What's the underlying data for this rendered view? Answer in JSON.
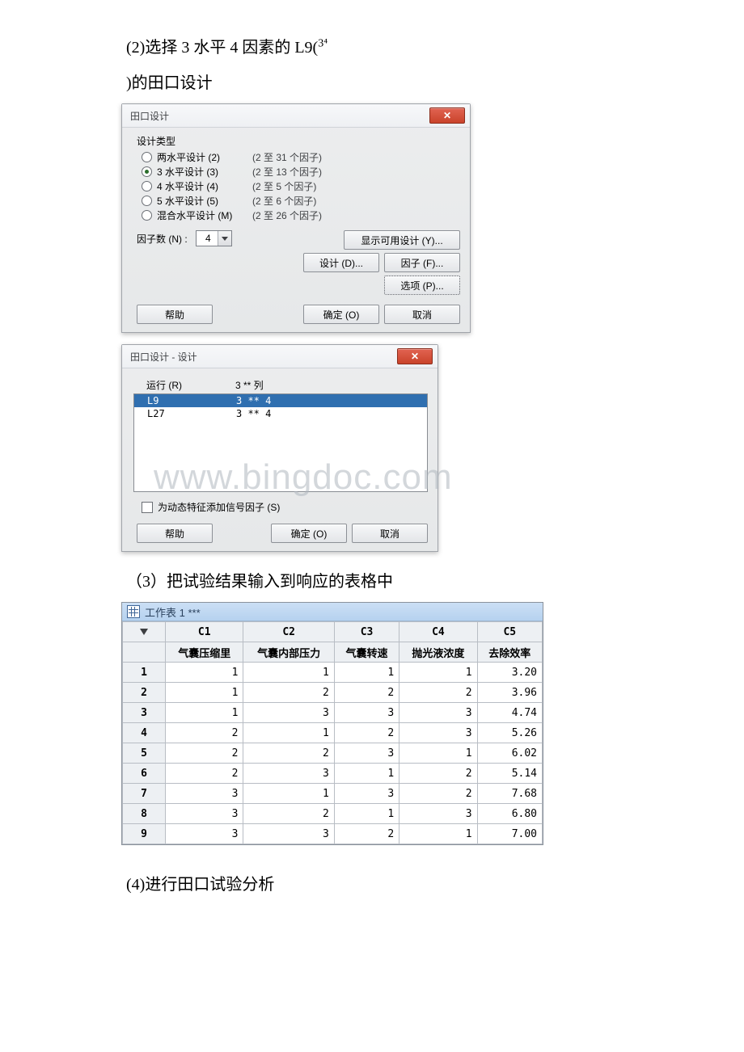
{
  "text": {
    "p1a": "(2)选择 3 水平 4 因素的 L9(",
    "p1sup": "3⁴",
    "p1b": ")的田口设计",
    "p3": "（3）把试验结果输入到响应的表格中",
    "p4": "(4)进行田口试验分析"
  },
  "watermark": "www.bingdoc.com",
  "dialog1": {
    "title": "田口设计",
    "group": "设计类型",
    "radios": [
      {
        "label": "两水平设计 (2)",
        "paren": "(2 至 31 个因子)",
        "selected": false
      },
      {
        "label": "3 水平设计 (3)",
        "paren": "(2 至 13 个因子)",
        "selected": true
      },
      {
        "label": "4 水平设计 (4)",
        "paren": "(2 至 5 个因子)",
        "selected": false
      },
      {
        "label": "5 水平设计 (5)",
        "paren": "(2 至 6 个因子)",
        "selected": false
      },
      {
        "label": "混合水平设计 (M)",
        "paren": "(2 至 26 个因子)",
        "selected": false
      }
    ],
    "factor_label": "因子数 (N) :",
    "factor_value": "4",
    "btn_show": "显示可用设计 (Y)...",
    "btn_design": "设计 (D)...",
    "btn_factor": "因子 (F)...",
    "btn_options": "选项 (P)...",
    "btn_help": "帮助",
    "btn_ok": "确定 (O)",
    "btn_cancel": "取消"
  },
  "dialog2": {
    "title": "田口设计 - 设计",
    "col1": "运行 (R)",
    "col2": "3 ** 列",
    "rows": [
      {
        "a": "L9",
        "b": "3 **  4",
        "sel": true
      },
      {
        "a": "L27",
        "b": "3 **  4",
        "sel": false
      }
    ],
    "chk_label": "为动态特征添加信号因子 (S)",
    "btn_help": "帮助",
    "btn_ok": "确定 (O)",
    "btn_cancel": "取消"
  },
  "worksheet": {
    "title": "工作表 1 ***",
    "cols": [
      "C1",
      "C2",
      "C3",
      "C4",
      "C5"
    ],
    "names": [
      "气囊压缩里",
      "气囊内部压力",
      "气囊转速",
      "抛光液浓度",
      "去除效率"
    ],
    "rows": [
      [
        "1",
        "1",
        "1",
        "1",
        "3.20"
      ],
      [
        "1",
        "2",
        "2",
        "2",
        "3.96"
      ],
      [
        "1",
        "3",
        "3",
        "3",
        "4.74"
      ],
      [
        "2",
        "1",
        "2",
        "3",
        "5.26"
      ],
      [
        "2",
        "2",
        "3",
        "1",
        "6.02"
      ],
      [
        "2",
        "3",
        "1",
        "2",
        "5.14"
      ],
      [
        "3",
        "1",
        "3",
        "2",
        "7.68"
      ],
      [
        "3",
        "2",
        "1",
        "3",
        "6.80"
      ],
      [
        "3",
        "3",
        "2",
        "1",
        "7.00"
      ]
    ]
  }
}
